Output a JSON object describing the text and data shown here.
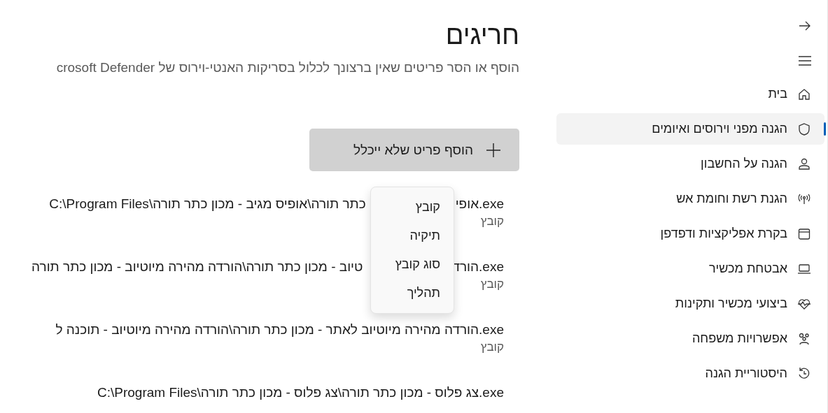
{
  "title": "חריגים",
  "subtitle": "הוסף או הסר פריטים שאין ברצונך לכלול בסריקות האנטי-וירוס של crosoft Defender",
  "add_button": {
    "label": "הוסף פריט שלא ייכלל"
  },
  "menu": {
    "items": [
      "קובץ",
      "תיקיה",
      "סוג קובץ",
      "תהליך"
    ]
  },
  "exclusions": [
    {
      "extension": ".exe",
      "name": "אופי",
      "path": "כתר תורה\\אופיס מגיב - מכון כתר תורה\\C:\\Program Files",
      "type": "קובץ"
    },
    {
      "extension": ".exe",
      "name": "הורד",
      "path": "טיוב - מכון כתר תורה\\הורדה מהירה מיוטיוב - מכון כתר תורה",
      "type": "קובץ"
    },
    {
      "extension": ".exe",
      "name": "הורדה מהירה מיוטיוב לאתר - מכון כתר תורה\\הורדה מהירה מיוטיוב - תוכנה ל",
      "type": "קובץ"
    },
    {
      "extension": ".exe",
      "name": "צג פלוס - מכון כתר תורה\\צג פלוס - מכון כתר תורה\\C:\\Program Files"
    }
  ],
  "sidebar": {
    "items": [
      {
        "label": "בית",
        "selected": false
      },
      {
        "label": "הגנה מפני וירוסים ואיומים",
        "selected": true
      },
      {
        "label": "הגנה על החשבון",
        "selected": false
      },
      {
        "label": "הגנת רשת וחומת אש",
        "selected": false
      },
      {
        "label": "בקרת אפליקציות ודפדפן",
        "selected": false
      },
      {
        "label": "אבטחת מכשיר",
        "selected": false
      },
      {
        "label": "ביצועי מכשיר ותקינות",
        "selected": false
      },
      {
        "label": "אפשרויות משפחה",
        "selected": false
      },
      {
        "label": "היסטוריית הגנה",
        "selected": false
      }
    ]
  }
}
